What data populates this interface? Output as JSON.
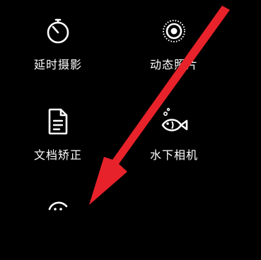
{
  "camera_more_modes": {
    "tiles": [
      {
        "id": "timelapse",
        "label": "延时摄影",
        "icon": "stopwatch-icon"
      },
      {
        "id": "livephoto",
        "label": "动态照片",
        "icon": "live-photo-icon"
      },
      {
        "id": "docscan",
        "label": "文档矫正",
        "icon": "document-icon"
      },
      {
        "id": "underwater",
        "label": "水下相机",
        "icon": "fish-icon"
      },
      {
        "id": "partial",
        "label": "",
        "icon": "camera-mode-icon"
      }
    ]
  },
  "annotation": {
    "arrow_color": "#e8222a",
    "icon_color": "#ffffff",
    "background_color": "#000000"
  }
}
